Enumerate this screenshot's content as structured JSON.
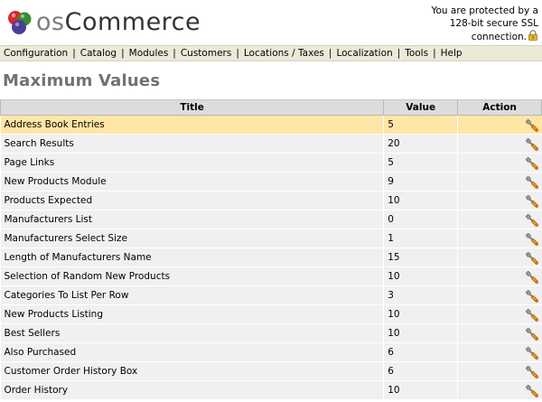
{
  "header": {
    "logo_prefix": "os",
    "logo_main": "Commerce",
    "ssl_lines": [
      "You are protected by a",
      "128-bit secure SSL",
      "connection."
    ]
  },
  "menu": [
    "Configuration",
    "Catalog",
    "Modules",
    "Customers",
    "Locations / Taxes",
    "Localization",
    "Tools",
    "Help"
  ],
  "page_title": "Maximum Values",
  "table": {
    "headers": {
      "title": "Title",
      "value": "Value",
      "action": "Action"
    },
    "rows": [
      {
        "title": "Address Book Entries",
        "value": "5",
        "selected": true
      },
      {
        "title": "Search Results",
        "value": "20"
      },
      {
        "title": "Page Links",
        "value": "5"
      },
      {
        "title": "New Products Module",
        "value": "9"
      },
      {
        "title": "Products Expected",
        "value": "10"
      },
      {
        "title": "Manufacturers List",
        "value": "0"
      },
      {
        "title": "Manufacturers Select Size",
        "value": "1"
      },
      {
        "title": "Length of Manufacturers Name",
        "value": "15"
      },
      {
        "title": "Selection of Random New Products",
        "value": "10"
      },
      {
        "title": "Categories To List Per Row",
        "value": "3"
      },
      {
        "title": "New Products Listing",
        "value": "10"
      },
      {
        "title": "Best Sellers",
        "value": "10"
      },
      {
        "title": "Also Purchased",
        "value": "6"
      },
      {
        "title": "Customer Order History Box",
        "value": "6"
      },
      {
        "title": "Order History",
        "value": "10"
      }
    ]
  },
  "colors": {
    "menu_bg": "#ece9d8",
    "row_bg": "#f0f0f0",
    "row_selected_bg": "#ffe5a6",
    "header_bg": "#dcdcdc",
    "title_color": "#727272"
  },
  "icons": {
    "logo": "oscommerce-logo-balls-icon",
    "ssl": "padlock-icon",
    "row_action": "wrench-edit-icon"
  }
}
